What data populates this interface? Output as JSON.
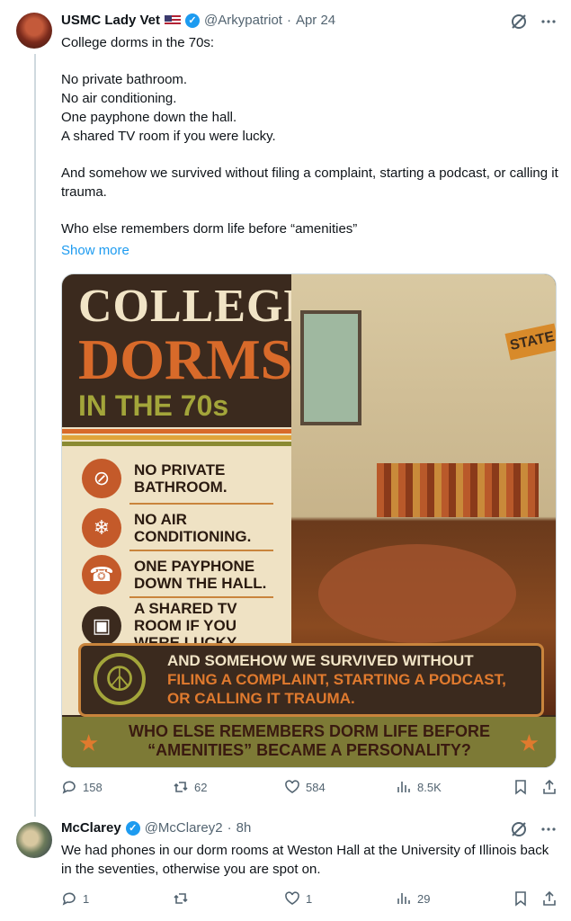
{
  "tweet": {
    "author_name": "USMC Lady Vet",
    "handle": "@Arkypatriot",
    "separator": "·",
    "date": "Apr 24",
    "text": "College dorms in the 70s:\n\nNo private bathroom.\nNo air conditioning.\nOne payphone down the hall.\nA shared TV room if you were lucky.\n\nAnd somehow we survived without filing a complaint, starting a podcast, or calling it trauma.\n\nWho else remembers dorm life before “amenities”",
    "show_more": "Show more",
    "image": {
      "title_line1": "COLLEGE",
      "title_line2": "DORMS",
      "title_line3": "IN THE 70s",
      "items": [
        {
          "text": "NO PRIVATE BATHROOM.",
          "icon": "toilet-icon"
        },
        {
          "text": "NO AIR CONDITIONING.",
          "icon": "snowflake-icon"
        },
        {
          "text": "ONE PAYPHONE DOWN THE HALL.",
          "icon": "payphone-icon"
        },
        {
          "text": "A SHARED TV ROOM IF YOU WERE LUCKY.",
          "icon": "tv-icon"
        }
      ],
      "survived_line1": "AND SOMEHOW WE SURVIVED WITHOUT",
      "survived_line2": "FILING A COMPLAINT, STARTING A PODCAST,",
      "survived_line3": "OR CALLING IT TRAUMA.",
      "footer_line1": "WHO ELSE REMEMBERS DORM LIFE BEFORE",
      "footer_line2": "“AMENITIES” BECAME A PERSONALITY?",
      "pennant": "STATE"
    },
    "stats": {
      "replies": "158",
      "reposts": "62",
      "likes": "584",
      "views": "8.5K"
    }
  },
  "reply": {
    "author_name": "McClarey",
    "handle": "@McClarey2",
    "separator": "·",
    "date": "8h",
    "text": "We had phones in our dorm rooms at Weston Hall at the University of Illinois back in the seventies, otherwise you are spot on.",
    "stats": {
      "replies": "1",
      "reposts": "",
      "likes": "1",
      "views": "29"
    }
  },
  "colors": {
    "accent": "#1d9bf0",
    "muted": "#536471",
    "text": "#0f1419"
  }
}
